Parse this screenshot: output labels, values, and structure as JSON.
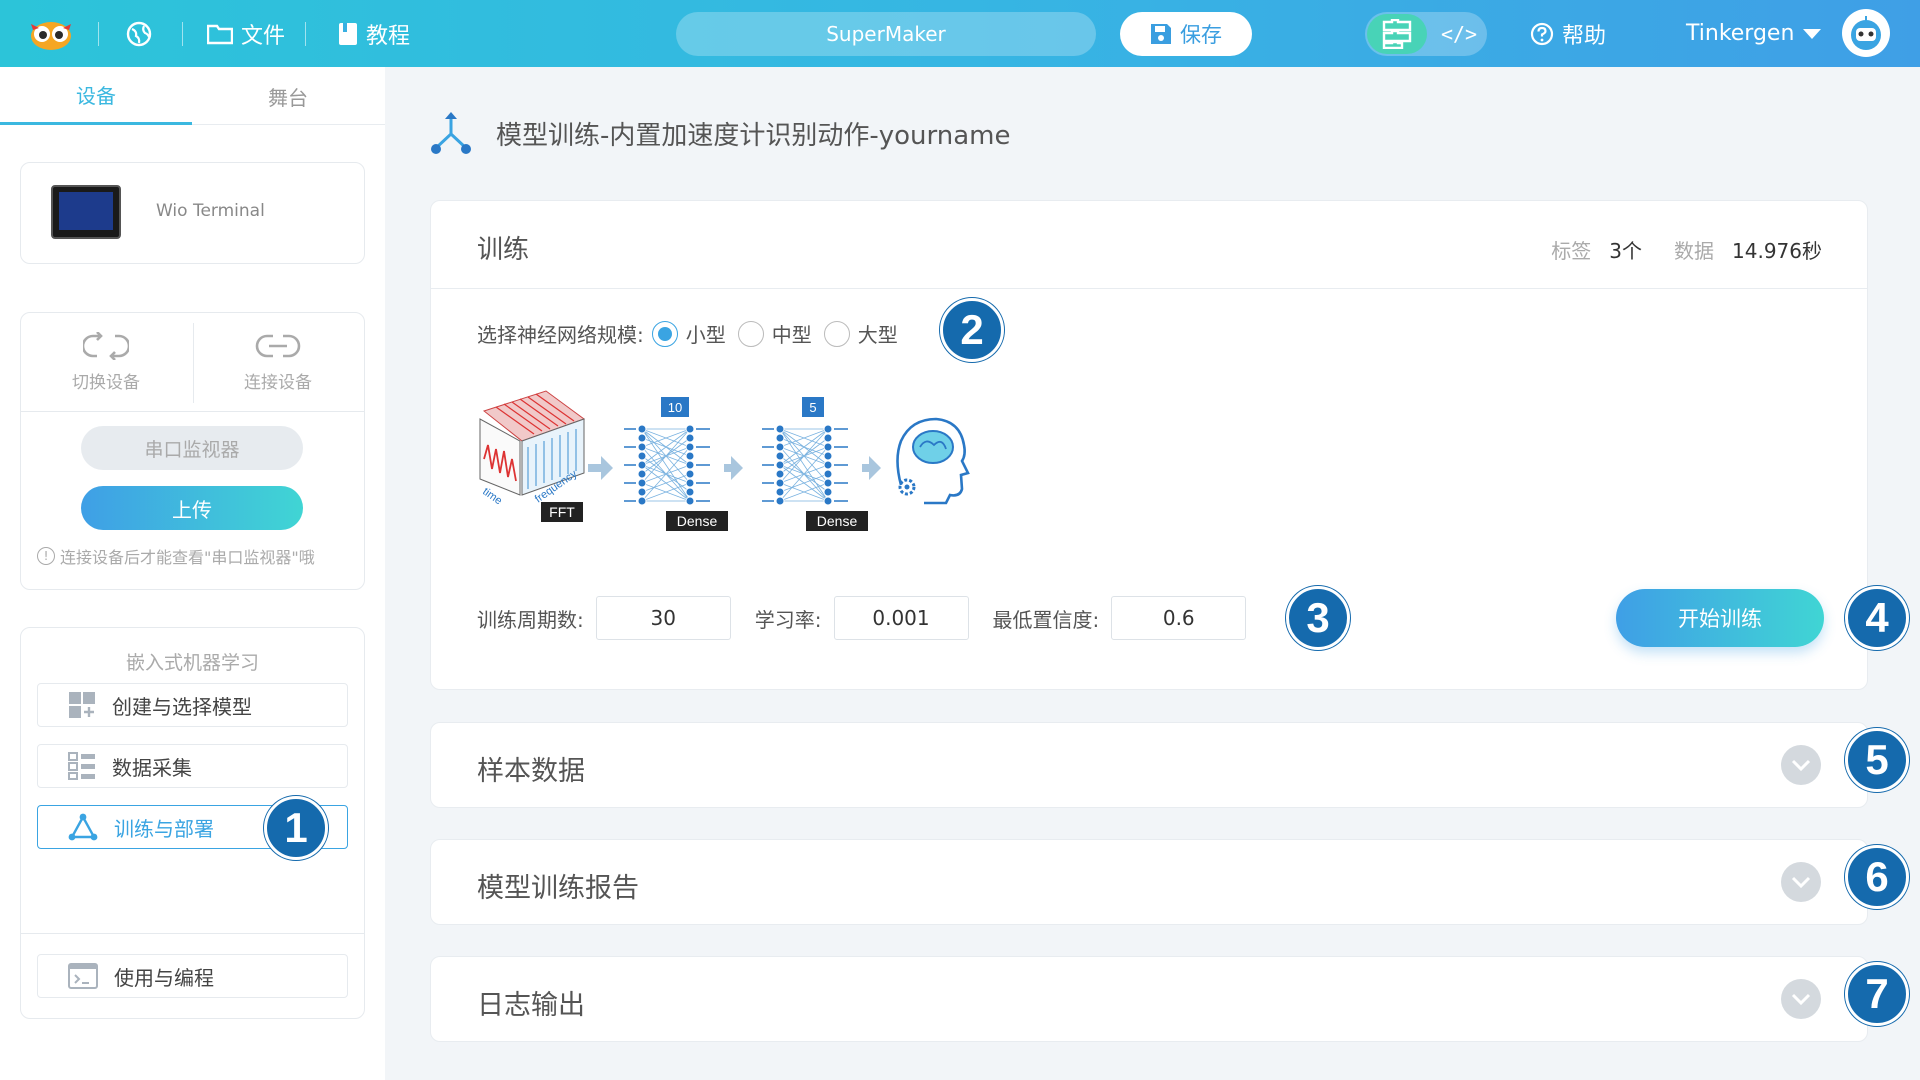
{
  "topbar": {
    "file_label": "文件",
    "tutorial_label": "教程",
    "project_name": "SuperMaker",
    "save_label": "保存",
    "code_toggle_label": "</>",
    "help_label": "帮助",
    "user_name": "Tinkergen"
  },
  "sidebar": {
    "tabs": [
      "设备",
      "舞台"
    ],
    "device_name": "Wio Terminal",
    "switch_device": "切换设备",
    "connect_device": "连接设备",
    "serial_monitor": "串口监视器",
    "upload": "上传",
    "hint": "连接设备后才能查看\"串口监视器\"哦",
    "ml_title": "嵌入式机器学习",
    "ml_items": [
      "创建与选择模型",
      "数据采集",
      "训练与部署",
      "使用与编程"
    ]
  },
  "main": {
    "title": "模型训练-内置加速度计识别动作-yourname",
    "train": {
      "title": "训练",
      "label_tag": "标签",
      "label_count": "3个",
      "data_tag": "数据",
      "data_value": "14.976秒",
      "scale_label": "选择神经网络规模:",
      "scale_options": [
        "小型",
        "中型",
        "大型"
      ],
      "scale_selected": "小型",
      "diagram": {
        "time_label": "time",
        "frequency_label": "frequency",
        "fft_label": "FFT",
        "dense1_units": "10",
        "dense2_units": "5",
        "dense_label": "Dense"
      },
      "epochs_label": "训练周期数:",
      "epochs_value": "30",
      "lr_label": "学习率:",
      "lr_value": "0.001",
      "conf_label": "最低置信度:",
      "conf_value": "0.6",
      "start_button": "开始训练"
    },
    "sections": [
      "样本数据",
      "模型训练报告",
      "日志输出"
    ]
  },
  "markers": [
    "1",
    "2",
    "3",
    "4",
    "5",
    "6",
    "7"
  ],
  "colors": {
    "accent": "#3aa4e2",
    "teal": "#40d5d4",
    "marker": "#156aad"
  }
}
